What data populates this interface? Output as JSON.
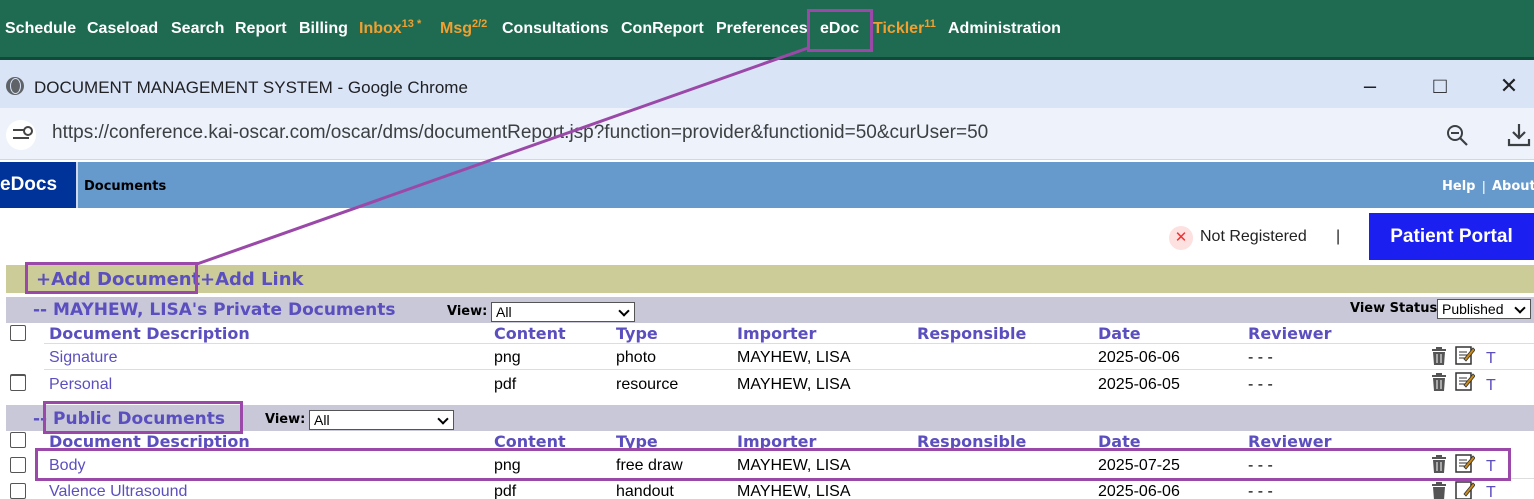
{
  "topnav": {
    "items": [
      {
        "label": "Schedule",
        "sup": ""
      },
      {
        "label": "Caseload",
        "sup": ""
      },
      {
        "label": "Search",
        "sup": ""
      },
      {
        "label": "Report",
        "sup": ""
      },
      {
        "label": "Billing",
        "sup": ""
      },
      {
        "label": "Inbox",
        "sup": "13 *"
      },
      {
        "label": "Msg",
        "sup": "2/2"
      },
      {
        "label": "Consultations",
        "sup": ""
      },
      {
        "label": "ConReport",
        "sup": ""
      },
      {
        "label": "Preferences",
        "sup": ""
      },
      {
        "label": "eDoc",
        "sup": ""
      },
      {
        "label": "Tickler",
        "sup": "11"
      },
      {
        "label": "Administration",
        "sup": ""
      }
    ],
    "bg_color": "#1f6b52",
    "alert_color": "#f0a030"
  },
  "window": {
    "title": "DOCUMENT MANAGEMENT SYSTEM - Google Chrome",
    "minimize": "–",
    "maximize": "□",
    "close": "✕",
    "url": "https://conference.kai-oscar.com/oscar/dms/documentReport.jsp?function=provider&functionid=50&curUser=50"
  },
  "edocs": {
    "tab_label": "eDocs",
    "section_label": "Documents",
    "help": "Help",
    "separator": "|",
    "about": "About"
  },
  "registration": {
    "status": "Not Registered",
    "separator": "|",
    "portal_button": "Patient Portal"
  },
  "actions": {
    "add_document": "+Add Document",
    "add_link": "+Add Link"
  },
  "view_status": {
    "label": "View Status",
    "selected": "Published"
  },
  "columns": [
    "Document Description",
    "Content",
    "Type",
    "Importer",
    "Responsible",
    "Date",
    "Reviewer"
  ],
  "private_section": {
    "title": "-- MAYHEW, LISA's Private Documents",
    "view_label": "View:",
    "view_selected": "All",
    "rows": [
      {
        "description": "Signature",
        "content": "png",
        "type": "photo",
        "importer": "MAYHEW, LISA",
        "responsible": "",
        "date": "2025-06-06",
        "reviewer": "- - -",
        "t": "T"
      },
      {
        "description": "Personal",
        "content": "pdf",
        "type": "resource",
        "importer": "MAYHEW, LISA",
        "responsible": "",
        "date": "2025-06-05",
        "reviewer": "- - -",
        "t": "T"
      }
    ]
  },
  "public_section": {
    "title": "-- Public Documents",
    "view_label": "View:",
    "view_selected": "All",
    "rows": [
      {
        "description": "Body",
        "content": "png",
        "type": "free draw",
        "importer": "MAYHEW, LISA",
        "responsible": "",
        "date": "2025-07-25",
        "reviewer": "- - -",
        "t": "T"
      },
      {
        "description": "Valence Ultrasound",
        "content": "pdf",
        "type": "handout",
        "importer": "MAYHEW, LISA",
        "responsible": "",
        "date": "2025-06-06",
        "reviewer": "- - -",
        "t": "T"
      }
    ]
  },
  "annotation_color": "#9b49a8"
}
